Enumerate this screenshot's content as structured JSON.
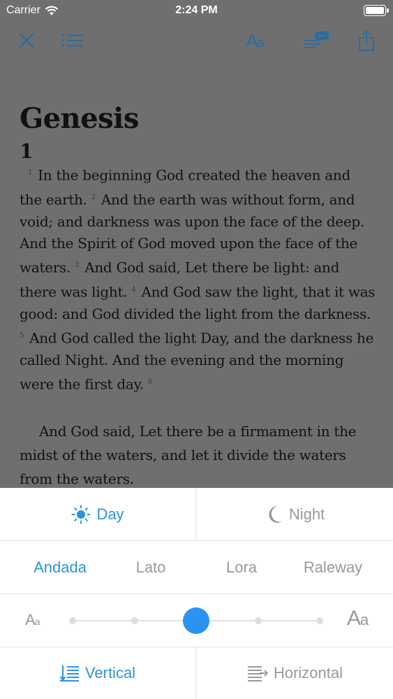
{
  "status_bar": {
    "carrier": "Carrier",
    "time": "2:24 PM"
  },
  "toolbar": {
    "close_icon": "close-icon",
    "toc_icon": "list-icon",
    "font_button": {
      "big": "A",
      "small": "a"
    },
    "notes_icon": "notes-bubble-icon",
    "share_icon": "share-icon"
  },
  "book": {
    "title": "Genesis",
    "chapter": "1",
    "verses": [
      {
        "num": "1",
        "text": "In the beginning God created the heaven and the earth."
      },
      {
        "num": "2",
        "text": "And the earth was without form, and void; and darkness was upon the face of the deep. And the Spirit of God moved upon the face of the waters."
      },
      {
        "num": "3",
        "text": "And God said, Let there be light: and there was light."
      },
      {
        "num": "4",
        "text": "And God saw the light, that it was good: and God divided the light from the darkness."
      },
      {
        "num": "5",
        "text": "And God called the light Day, and the darkness he called Night. And the evening and the morning were the first day."
      },
      {
        "num": "6",
        "text": ""
      }
    ],
    "next_paragraph": "And God said, Let there be a firmament in the midst of the waters, and let it divide the waters from the waters."
  },
  "settings": {
    "theme": {
      "day": "Day",
      "night": "Night",
      "selected": "Day"
    },
    "fonts": [
      {
        "label": "Andada",
        "selected": true
      },
      {
        "label": "Lato",
        "selected": false
      },
      {
        "label": "Lora",
        "selected": false
      },
      {
        "label": "Raleway",
        "selected": false
      }
    ],
    "font_size": {
      "small": {
        "big": "A",
        "small": "a"
      },
      "large": {
        "big": "A",
        "small": "a"
      },
      "steps": 5,
      "selected_step": 2
    },
    "scroll": {
      "vertical": "Vertical",
      "horizontal": "Horizontal",
      "selected": "Vertical"
    }
  },
  "colors": {
    "accent": "#2b94df",
    "toolbar_icon": "#2c6d9c",
    "inactive": "#9a9a9a",
    "dim_overlay": "#6f6f6f"
  }
}
